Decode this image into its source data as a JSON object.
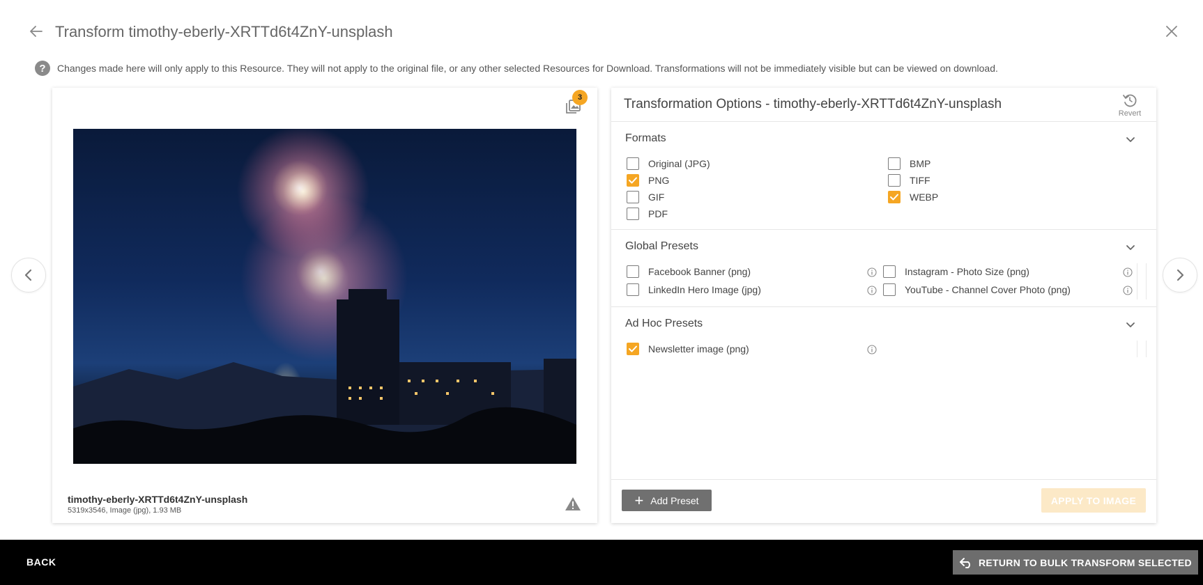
{
  "header": {
    "title": "Transform timothy-eberly-XRTTd6t4ZnY-unsplash",
    "notice": "Changes made here will only apply to this Resource. They will not apply to the original file, or any other selected Resources for Download. Transformations will not be immediately visible but can be viewed on download."
  },
  "preview": {
    "badge_count": "3",
    "file_name": "timothy-eberly-XRTTd6t4ZnY-unsplash",
    "file_meta": "5319x3546, Image (jpg), 1.93 MB"
  },
  "options": {
    "title": "Transformation Options - timothy-eberly-XRTTd6t4ZnY-unsplash",
    "revert_label": "Revert",
    "formats": {
      "title": "Formats",
      "items": [
        {
          "label": "Original (JPG)",
          "checked": false
        },
        {
          "label": "PNG",
          "checked": true
        },
        {
          "label": "GIF",
          "checked": false
        },
        {
          "label": "PDF",
          "checked": false
        },
        {
          "label": "BMP",
          "checked": false
        },
        {
          "label": "TIFF",
          "checked": false
        },
        {
          "label": "WEBP",
          "checked": true
        }
      ]
    },
    "global_presets": {
      "title": "Global Presets",
      "items": [
        {
          "label": "Facebook Banner (png)",
          "checked": false
        },
        {
          "label": "LinkedIn Hero Image (jpg)",
          "checked": false
        },
        {
          "label": "Instagram - Photo Size (png)",
          "checked": false
        },
        {
          "label": "YouTube - Channel Cover Photo (png)",
          "checked": false
        }
      ]
    },
    "adhoc_presets": {
      "title": "Ad Hoc Presets",
      "items": [
        {
          "label": "Newsletter image (png)",
          "checked": true
        }
      ]
    },
    "add_preset_label": "Add Preset",
    "apply_label": "APPLY TO IMAGE"
  },
  "footer": {
    "back_label": "BACK",
    "return_label": "RETURN TO BULK TRANSFORM SELECTED"
  },
  "colors": {
    "accent": "#f5a623",
    "apply_disabled": "#fce9c7",
    "bottom_bar": "#000000",
    "secondary_button": "#707070"
  }
}
